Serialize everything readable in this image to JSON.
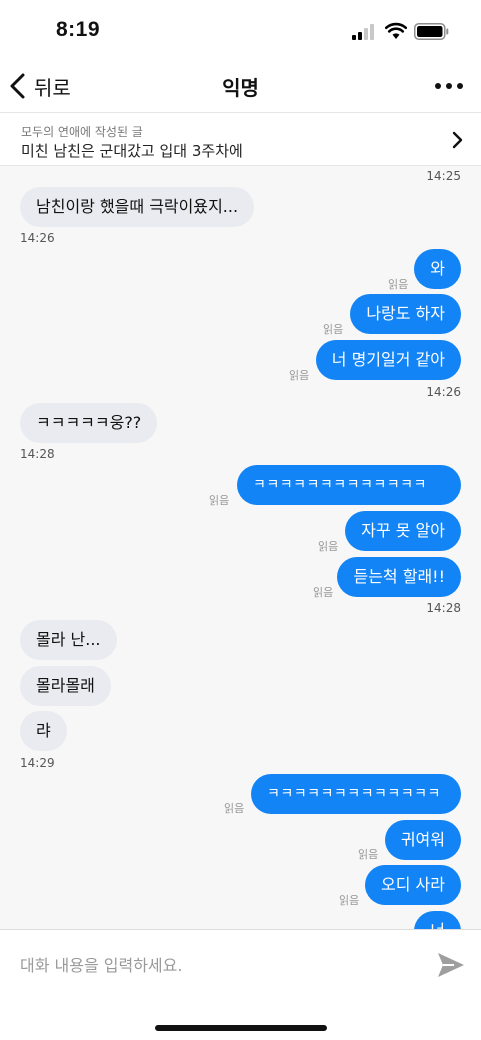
{
  "status_bar": {
    "time": "8:19"
  },
  "header": {
    "back_label": "뒤로",
    "title": "익명"
  },
  "post_link": {
    "board": "모두의 연애에 작성된 글",
    "title": "미친 남친은 군대갔고 입대 3주차에"
  },
  "messages": [
    {
      "dir": "time",
      "text": "14:25"
    },
    {
      "dir": "in",
      "text": "남친이랑 했을때 극락이욨지..."
    },
    {
      "dir": "time",
      "text": "14:26"
    },
    {
      "dir": "out",
      "text": "와",
      "read": "읽음"
    },
    {
      "dir": "out",
      "text": "나랑도 하자",
      "read": "읽음"
    },
    {
      "dir": "out",
      "text": "너 명기일거 같아",
      "read": "읽음"
    },
    {
      "dir": "time",
      "text": "14:26"
    },
    {
      "dir": "in",
      "text": "ㅋㅋㅋㅋㅋ웅??"
    },
    {
      "dir": "time",
      "text": "14:28"
    },
    {
      "dir": "out",
      "text": "ㅋㅋㅋㅋㅋㅋㅋㅋㅋㅋㅋㅋㅋ",
      "read": "읽음"
    },
    {
      "dir": "out",
      "text": "자꾸 못 알아",
      "read": "읽음"
    },
    {
      "dir": "out",
      "text": "듣는척 할래!!",
      "read": "읽음"
    },
    {
      "dir": "time",
      "text": "14:28"
    },
    {
      "dir": "in",
      "text": "몰라 난..."
    },
    {
      "dir": "in",
      "text": "몰라몰래"
    },
    {
      "dir": "in",
      "text": "랴"
    },
    {
      "dir": "time",
      "text": "14:29"
    },
    {
      "dir": "out",
      "text": "ㅋㅋㅋㅋㅋㅋㅋㅋㅋㅋㅋㅋㅋ",
      "read": "읽음"
    },
    {
      "dir": "out",
      "text": "귀여워",
      "read": "읽음"
    },
    {
      "dir": "out",
      "text": "오디 사라",
      "read": "읽음"
    },
    {
      "dir": "out",
      "text": "너"
    }
  ],
  "input": {
    "placeholder": "대화 내용을 입력하세요."
  },
  "colors": {
    "outgoing_bubble": "#1284f6",
    "incoming_bubble": "#e9ebf0",
    "chat_background": "#f7f7f7"
  }
}
